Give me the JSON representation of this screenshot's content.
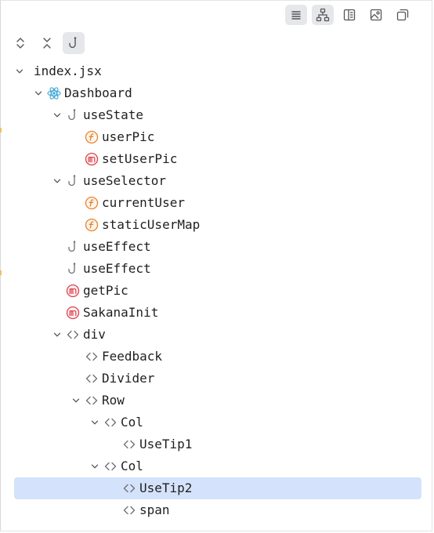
{
  "colors": {
    "selection": "#d4e2fb",
    "function_icon": "#e8822a",
    "method_icon": "#d9434d",
    "react_icon": "#3aa3d8",
    "neutral_icon": "#6e6e73"
  },
  "toolbar": {
    "buttons": [
      {
        "icon": "list-lines-icon",
        "active": true
      },
      {
        "icon": "hierarchy-icon",
        "active": true
      },
      {
        "icon": "panel-icon",
        "active": false
      },
      {
        "icon": "image-icon",
        "active": false
      },
      {
        "icon": "copy-window-icon",
        "active": false
      }
    ]
  },
  "tree_toolbar": {
    "buttons": [
      {
        "icon": "expand-all-icon",
        "active": false
      },
      {
        "icon": "collapse-all-icon",
        "active": false
      },
      {
        "icon": "hook-icon",
        "active": true
      }
    ]
  },
  "tree": [
    {
      "label": "index.jsx",
      "depth": 0,
      "expanded": true,
      "icon": "none"
    },
    {
      "label": "Dashboard",
      "depth": 1,
      "expanded": true,
      "icon": "react-icon"
    },
    {
      "label": "useState",
      "depth": 2,
      "expanded": true,
      "icon": "hook-icon"
    },
    {
      "label": "userPic",
      "depth": 3,
      "expanded": null,
      "icon": "function-icon"
    },
    {
      "label": "setUserPic",
      "depth": 3,
      "expanded": null,
      "icon": "method-icon"
    },
    {
      "label": "useSelector",
      "depth": 2,
      "expanded": true,
      "icon": "hook-icon"
    },
    {
      "label": "currentUser",
      "depth": 3,
      "expanded": null,
      "icon": "function-icon"
    },
    {
      "label": "staticUserMap",
      "depth": 3,
      "expanded": null,
      "icon": "function-icon"
    },
    {
      "label": "useEffect",
      "depth": 2,
      "expanded": null,
      "icon": "hook-icon"
    },
    {
      "label": "useEffect",
      "depth": 2,
      "expanded": null,
      "icon": "hook-icon"
    },
    {
      "label": "getPic",
      "depth": 2,
      "expanded": null,
      "icon": "method-icon"
    },
    {
      "label": "SakanaInit",
      "depth": 2,
      "expanded": null,
      "icon": "method-icon"
    },
    {
      "label": "div",
      "depth": 2,
      "expanded": true,
      "icon": "tag-icon"
    },
    {
      "label": "Feedback",
      "depth": 3,
      "expanded": null,
      "icon": "tag-icon"
    },
    {
      "label": "Divider",
      "depth": 3,
      "expanded": null,
      "icon": "tag-icon"
    },
    {
      "label": "Row",
      "depth": 3,
      "expanded": true,
      "icon": "tag-icon"
    },
    {
      "label": "Col",
      "depth": 4,
      "expanded": true,
      "icon": "tag-icon"
    },
    {
      "label": "UseTip1",
      "depth": 5,
      "expanded": null,
      "icon": "tag-icon"
    },
    {
      "label": "Col",
      "depth": 4,
      "expanded": true,
      "icon": "tag-icon"
    },
    {
      "label": "UseTip2",
      "depth": 5,
      "expanded": null,
      "icon": "tag-icon",
      "selected": true
    },
    {
      "label": "span",
      "depth": 5,
      "expanded": null,
      "icon": "tag-icon"
    }
  ]
}
